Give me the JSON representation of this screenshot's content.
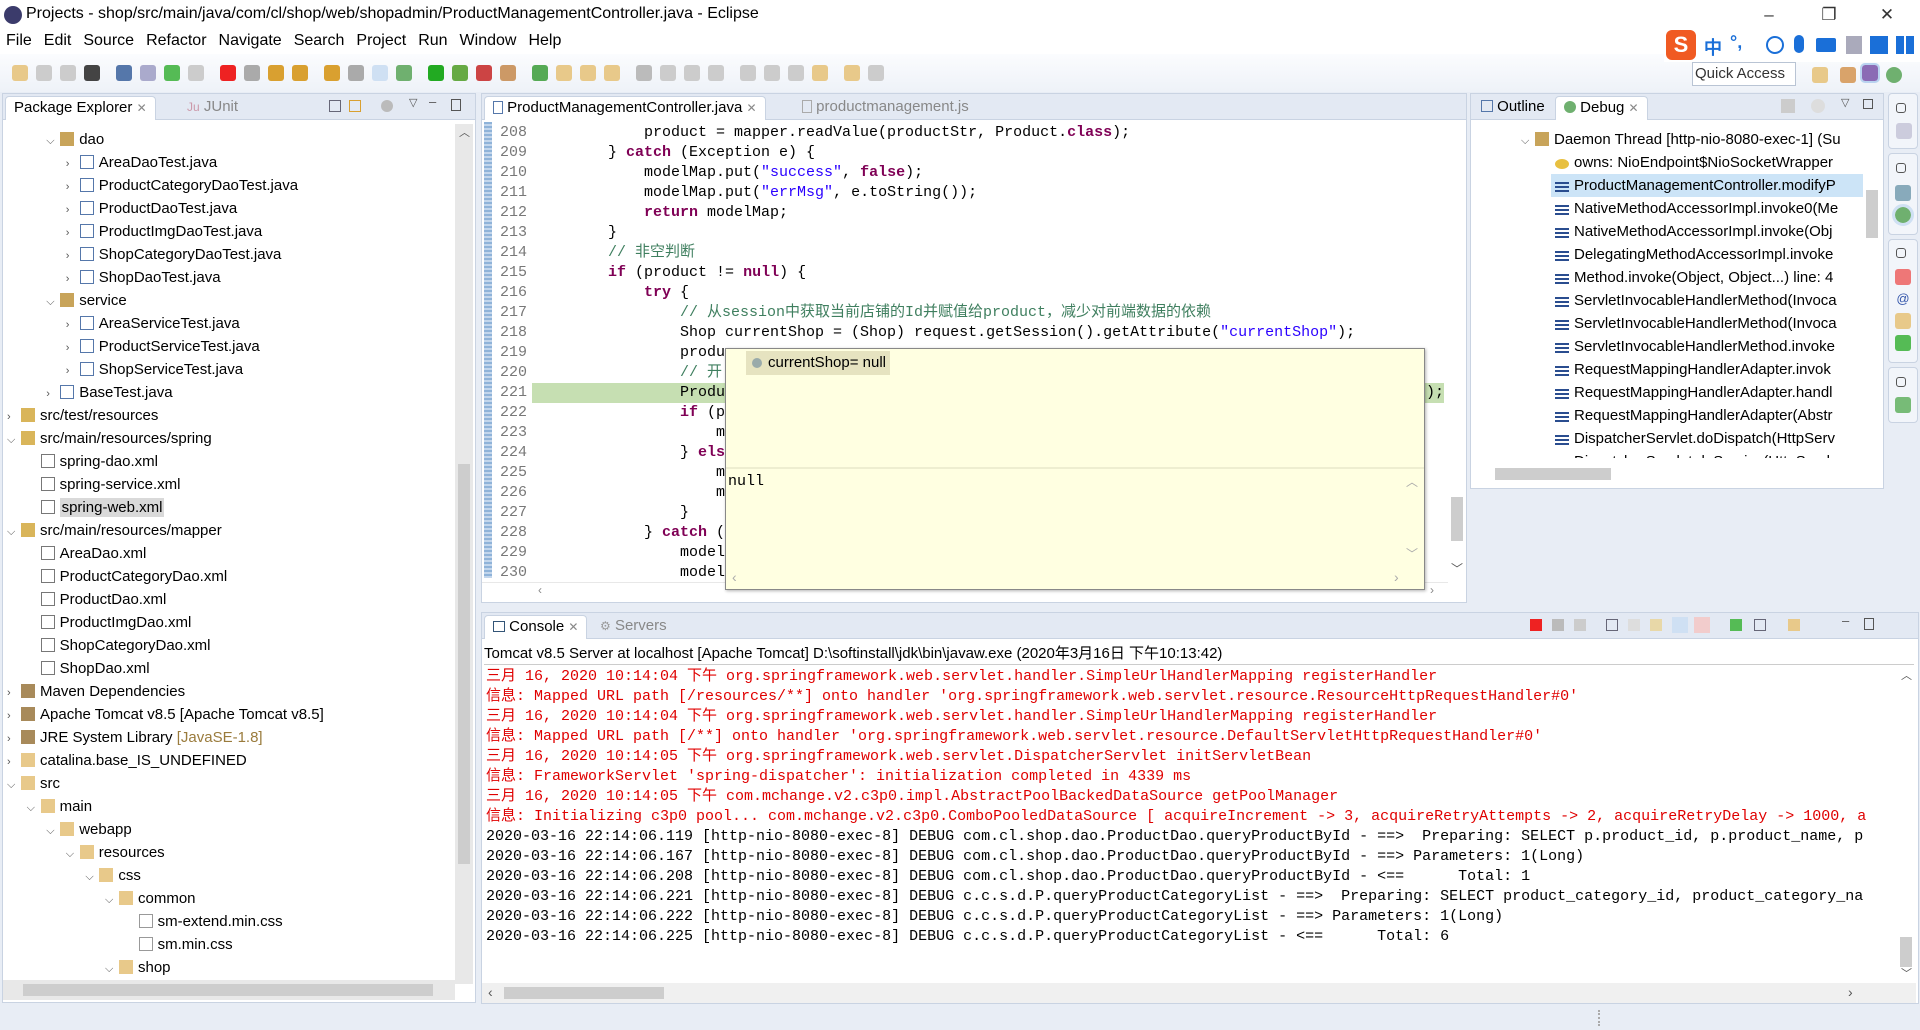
{
  "window": {
    "title": "Projects - shop/src/main/java/com/cl/shop/web/shopadmin/ProductManagementController.java - Eclipse",
    "minimize": "–",
    "maximize": "❐",
    "close": "✕"
  },
  "menu": [
    "File",
    "Edit",
    "Source",
    "Refactor",
    "Navigate",
    "Search",
    "Project",
    "Run",
    "Window",
    "Help"
  ],
  "quick_access": "Quick Access",
  "ime": {
    "lang": "中",
    "punct": "°,"
  },
  "explorer": {
    "tabs": [
      "Package Explorer",
      "JUnit"
    ],
    "items": [
      {
        "label": "dao",
        "lvl": 2,
        "exp": "open",
        "icon": "package"
      },
      {
        "label": "AreaDaoTest.java",
        "lvl": 3,
        "exp": "closed",
        "icon": "java"
      },
      {
        "label": "ProductCategoryDaoTest.java",
        "lvl": 3,
        "exp": "closed",
        "icon": "java"
      },
      {
        "label": "ProductDaoTest.java",
        "lvl": 3,
        "exp": "closed",
        "icon": "java"
      },
      {
        "label": "ProductImgDaoTest.java",
        "lvl": 3,
        "exp": "closed",
        "icon": "java"
      },
      {
        "label": "ShopCategoryDaoTest.java",
        "lvl": 3,
        "exp": "closed",
        "icon": "java"
      },
      {
        "label": "ShopDaoTest.java",
        "lvl": 3,
        "exp": "closed",
        "icon": "java"
      },
      {
        "label": "service",
        "lvl": 2,
        "exp": "open",
        "icon": "package"
      },
      {
        "label": "AreaServiceTest.java",
        "lvl": 3,
        "exp": "closed",
        "icon": "java"
      },
      {
        "label": "ProductServiceTest.java",
        "lvl": 3,
        "exp": "closed",
        "icon": "java"
      },
      {
        "label": "ShopServiceTest.java",
        "lvl": 3,
        "exp": "closed",
        "icon": "java"
      },
      {
        "label": "BaseTest.java",
        "lvl": 2,
        "exp": "closed",
        "icon": "java"
      },
      {
        "label": "src/test/resources",
        "lvl": 0,
        "exp": "closed",
        "icon": "srcfolder"
      },
      {
        "label": "src/main/resources/spring",
        "lvl": 0,
        "exp": "open",
        "icon": "srcfolder"
      },
      {
        "label": "spring-dao.xml",
        "lvl": 1,
        "exp": "",
        "icon": "xml"
      },
      {
        "label": "spring-service.xml",
        "lvl": 1,
        "exp": "",
        "icon": "xml"
      },
      {
        "label": "spring-web.xml",
        "lvl": 1,
        "exp": "",
        "icon": "xml",
        "selected": true
      },
      {
        "label": "src/main/resources/mapper",
        "lvl": 0,
        "exp": "open",
        "icon": "srcfolder"
      },
      {
        "label": "AreaDao.xml",
        "lvl": 1,
        "exp": "",
        "icon": "xml"
      },
      {
        "label": "ProductCategoryDao.xml",
        "lvl": 1,
        "exp": "",
        "icon": "xml"
      },
      {
        "label": "ProductDao.xml",
        "lvl": 1,
        "exp": "",
        "icon": "xml"
      },
      {
        "label": "ProductImgDao.xml",
        "lvl": 1,
        "exp": "",
        "icon": "xml"
      },
      {
        "label": "ShopCategoryDao.xml",
        "lvl": 1,
        "exp": "",
        "icon": "xml"
      },
      {
        "label": "ShopDao.xml",
        "lvl": 1,
        "exp": "",
        "icon": "xml"
      },
      {
        "label": "Maven Dependencies",
        "lvl": 0,
        "exp": "closed",
        "icon": "library"
      },
      {
        "label": "Apache Tomcat v8.5 [Apache Tomcat v8.5]",
        "lvl": 0,
        "exp": "closed",
        "icon": "library"
      },
      {
        "label": "JRE System Library",
        "suffix": "[JavaSE-1.8]",
        "lvl": 0,
        "exp": "closed",
        "icon": "library"
      },
      {
        "label": "catalina.base_IS_UNDEFINED",
        "lvl": 0,
        "exp": "closed",
        "icon": "folder"
      },
      {
        "label": "src",
        "lvl": 0,
        "exp": "open",
        "icon": "folder"
      },
      {
        "label": "main",
        "lvl": 1,
        "exp": "open",
        "icon": "folder"
      },
      {
        "label": "webapp",
        "lvl": 2,
        "exp": "open",
        "icon": "folder"
      },
      {
        "label": "resources",
        "lvl": 3,
        "exp": "open",
        "icon": "folder"
      },
      {
        "label": "css",
        "lvl": 4,
        "exp": "open",
        "icon": "folder"
      },
      {
        "label": "common",
        "lvl": 5,
        "exp": "open",
        "icon": "folder"
      },
      {
        "label": "sm-extend.min.css",
        "lvl": 6,
        "exp": "",
        "icon": "file"
      },
      {
        "label": "sm.min.css",
        "lvl": 6,
        "exp": "",
        "icon": "file"
      },
      {
        "label": "shop",
        "lvl": 5,
        "exp": "open",
        "icon": "folder"
      }
    ]
  },
  "editor": {
    "tabs": [
      "ProductManagementController.java",
      "productmanagement.js"
    ],
    "current_line": 221,
    "lines": [
      {
        "n": "208",
        "segs": [
          {
            "t": "            product = mapper.readValue(productStr, Product."
          },
          {
            "t": "class",
            "k": "kw"
          },
          {
            "t": ");"
          }
        ]
      },
      {
        "n": "209",
        "segs": [
          {
            "t": "        } "
          },
          {
            "t": "catch",
            "k": "kw"
          },
          {
            "t": " (Exception e) {"
          }
        ]
      },
      {
        "n": "210",
        "segs": [
          {
            "t": "            modelMap.put("
          },
          {
            "t": "\"success\"",
            "k": "str"
          },
          {
            "t": ", "
          },
          {
            "t": "false",
            "k": "kw"
          },
          {
            "t": ");"
          }
        ]
      },
      {
        "n": "211",
        "segs": [
          {
            "t": "            modelMap.put("
          },
          {
            "t": "\"errMsg\"",
            "k": "str"
          },
          {
            "t": ", e.toString());"
          }
        ]
      },
      {
        "n": "212",
        "segs": [
          {
            "t": "            "
          },
          {
            "t": "return",
            "k": "kw"
          },
          {
            "t": " modelMap;"
          }
        ]
      },
      {
        "n": "213",
        "segs": [
          {
            "t": "        }"
          }
        ]
      },
      {
        "n": "214",
        "segs": [
          {
            "t": "        // 非空判断",
            "k": "cmt"
          }
        ]
      },
      {
        "n": "215",
        "segs": [
          {
            "t": "        "
          },
          {
            "t": "if",
            "k": "kw"
          },
          {
            "t": " (product != "
          },
          {
            "t": "null",
            "k": "kw"
          },
          {
            "t": ") {"
          }
        ]
      },
      {
        "n": "216",
        "segs": [
          {
            "t": "            "
          },
          {
            "t": "try",
            "k": "kw"
          },
          {
            "t": " {"
          }
        ]
      },
      {
        "n": "217",
        "segs": [
          {
            "t": "                // 从session中获取当前店铺的Id并赋值给product，减少对前端数据的依赖",
            "k": "cmt"
          }
        ]
      },
      {
        "n": "218",
        "segs": [
          {
            "t": "                Shop currentShop = (Shop) request.getSession().getAttribute("
          },
          {
            "t": "\"currentShop\"",
            "k": "str"
          },
          {
            "t": ");"
          }
        ]
      },
      {
        "n": "219",
        "segs": [
          {
            "t": "                produ"
          }
        ]
      },
      {
        "n": "220",
        "segs": [
          {
            "t": "                // 开",
            "k": "cmt"
          }
        ]
      },
      {
        "n": "221",
        "segs": [
          {
            "t": "                Produ"
          }
        ],
        "tail": "st);"
      },
      {
        "n": "222",
        "segs": [
          {
            "t": "                "
          },
          {
            "t": "if",
            "k": "kw"
          },
          {
            "t": " (p"
          }
        ]
      },
      {
        "n": "223",
        "segs": [
          {
            "t": "                    m"
          }
        ]
      },
      {
        "n": "224",
        "segs": [
          {
            "t": "                } "
          },
          {
            "t": "els",
            "k": "kw"
          }
        ]
      },
      {
        "n": "225",
        "segs": [
          {
            "t": "                    m"
          }
        ]
      },
      {
        "n": "226",
        "segs": [
          {
            "t": "                    m"
          }
        ]
      },
      {
        "n": "227",
        "segs": [
          {
            "t": "                }"
          }
        ]
      },
      {
        "n": "228",
        "segs": [
          {
            "t": "            } "
          },
          {
            "t": "catch",
            "k": "kw"
          },
          {
            "t": " ("
          }
        ]
      },
      {
        "n": "229",
        "segs": [
          {
            "t": "                model"
          }
        ]
      },
      {
        "n": "230",
        "segs": [
          {
            "t": "                model"
          }
        ]
      }
    ],
    "hover": {
      "expression": "currentShop= null",
      "detail": "null"
    }
  },
  "debug": {
    "tabs": [
      "Outline",
      "Debug"
    ],
    "thread": "Daemon Thread [http-nio-8080-exec-1] (Su",
    "owns": "owns: NioEndpoint$NioSocketWrapper",
    "frames": [
      "ProductManagementController.modifyP",
      "NativeMethodAccessorImpl.invoke0(Me",
      "NativeMethodAccessorImpl.invoke(Obj",
      "DelegatingMethodAccessorImpl.invoke",
      "Method.invoke(Object, Object...) line: 4",
      "ServletInvocableHandlerMethod(Invoca",
      "ServletInvocableHandlerMethod(Invoca",
      "ServletInvocableHandlerMethod.invoke",
      "RequestMappingHandlerAdapter.invok",
      "RequestMappingHandlerAdapter.handl",
      "RequestMappingHandlerAdapter(Abstr",
      "DispatcherServlet.doDispatch(HttpServ",
      "DispatcherServlet.doService(HttpServle"
    ],
    "selected_frame": 0
  },
  "console": {
    "tabs": [
      "Console",
      "Servers"
    ],
    "header": "Tomcat v8.5 Server at localhost [Apache Tomcat] D:\\softinstall\\jdk\\bin\\javaw.exe (2020年3月16日 下午10:13:42)",
    "lines": [
      {
        "t": "三月 16, 2020 10:14:04 下午 org.springframework.web.servlet.handler.SimpleUrlHandlerMapping registerHandler",
        "err": true
      },
      {
        "t": "信息: Mapped URL path [/resources/**] onto handler 'org.springframework.web.servlet.resource.ResourceHttpRequestHandler#0'",
        "err": true
      },
      {
        "t": "三月 16, 2020 10:14:04 下午 org.springframework.web.servlet.handler.SimpleUrlHandlerMapping registerHandler",
        "err": true
      },
      {
        "t": "信息: Mapped URL path [/**] onto handler 'org.springframework.web.servlet.resource.DefaultServletHttpRequestHandler#0'",
        "err": true
      },
      {
        "t": "三月 16, 2020 10:14:05 下午 org.springframework.web.servlet.DispatcherServlet initServletBean",
        "err": true
      },
      {
        "t": "信息: FrameworkServlet 'spring-dispatcher': initialization completed in 4339 ms",
        "err": true
      },
      {
        "t": "三月 16, 2020 10:14:05 下午 com.mchange.v2.c3p0.impl.AbstractPoolBackedDataSource getPoolManager",
        "err": true
      },
      {
        "t": "信息: Initializing c3p0 pool... com.mchange.v2.c3p0.ComboPooledDataSource [ acquireIncrement -> 3, acquireRetryAttempts -> 2, acquireRetryDelay -> 1000, a",
        "err": true
      },
      {
        "t": "2020-03-16 22:14:06.119 [http-nio-8080-exec-8] DEBUG com.cl.shop.dao.ProductDao.queryProductById - ==>  Preparing: SELECT p.product_id, p.product_name, p",
        "err": false
      },
      {
        "t": "2020-03-16 22:14:06.167 [http-nio-8080-exec-8] DEBUG com.cl.shop.dao.ProductDao.queryProductById - ==> Parameters: 1(Long)",
        "err": false
      },
      {
        "t": "2020-03-16 22:14:06.208 [http-nio-8080-exec-8] DEBUG com.cl.shop.dao.ProductDao.queryProductById - <==      Total: 1",
        "err": false
      },
      {
        "t": "2020-03-16 22:14:06.221 [http-nio-8080-exec-8] DEBUG c.c.s.d.P.queryProductCategoryList - ==>  Preparing: SELECT product_category_id, product_category_na",
        "err": false
      },
      {
        "t": "2020-03-16 22:14:06.222 [http-nio-8080-exec-8] DEBUG c.c.s.d.P.queryProductCategoryList - ==> Parameters: 1(Long)",
        "err": false
      },
      {
        "t": "2020-03-16 22:14:06.225 [http-nio-8080-exec-8] DEBUG c.c.s.d.P.queryProductCategoryList - <==      Total: 6",
        "err": false
      }
    ]
  },
  "colors": {
    "keyword": "#7f0055",
    "string": "#2a00ff",
    "comment": "#3f7f5f",
    "console_error": "#e00000",
    "current_line": "#c6dfb2",
    "selection": "#cce4f7",
    "hover_bg": "#ffffe1"
  }
}
